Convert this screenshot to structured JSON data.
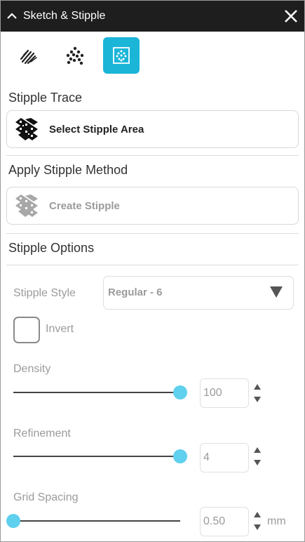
{
  "titlebar": {
    "title": "Sketch & Stipple"
  },
  "tools": [
    {
      "icon": "sketch-icon",
      "active": false
    },
    {
      "icon": "stipple-dots-icon",
      "active": false
    },
    {
      "icon": "stipple-grid-icon",
      "active": true
    }
  ],
  "stipple_trace": {
    "title": "Stipple Trace",
    "button_label": "Select Stipple Area",
    "icon": "stipple-area-icon"
  },
  "apply_method": {
    "title": "Apply Stipple Method",
    "button_label": "Create Stipple",
    "icon": "stipple-area-icon",
    "enabled": false
  },
  "options": {
    "title": "Stipple Options",
    "style_label": "Stipple Style",
    "style_value": "Regular - 6",
    "invert_label": "Invert",
    "invert_checked": false,
    "density": {
      "label": "Density",
      "value": "100",
      "fraction": 1.0
    },
    "refinement": {
      "label": "Refinement",
      "value": "4",
      "fraction": 1.0
    },
    "grid_spacing": {
      "label": "Grid Spacing",
      "value": "0.50",
      "unit": "mm",
      "fraction": 0.0
    }
  },
  "colors": {
    "accent": "#1bb5d8",
    "thumb": "#5fd0ee",
    "titlebar": "#1e1e1e",
    "muted": "#9b9b9b"
  }
}
